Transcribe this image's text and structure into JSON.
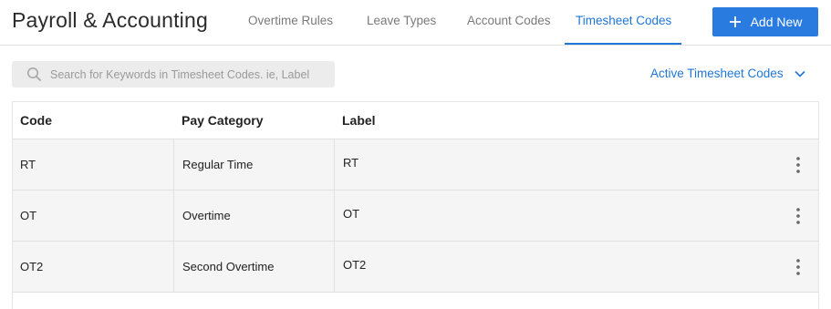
{
  "header": {
    "title": "Payroll & Accounting",
    "tabs": [
      {
        "label": "Overtime Rules",
        "active": false
      },
      {
        "label": "Leave Types",
        "active": false
      },
      {
        "label": "Account Codes",
        "active": false
      },
      {
        "label": "Timesheet Codes",
        "active": true
      }
    ],
    "add_button_label": "Add New"
  },
  "search": {
    "placeholder": "Search for Keywords in Timesheet Codes. ie, Label",
    "value": ""
  },
  "filter": {
    "selected": "Active Timesheet Codes"
  },
  "table": {
    "columns": [
      "Code",
      "Pay Category",
      "Label"
    ],
    "rows": [
      {
        "code": "RT",
        "pay_category": "Regular Time",
        "label": "RT"
      },
      {
        "code": "OT",
        "pay_category": "Overtime",
        "label": "OT"
      },
      {
        "code": "OT2",
        "pay_category": "Second Overtime",
        "label": "OT2"
      }
    ]
  },
  "colors": {
    "accent": "#1f76d6",
    "button": "#2a7be0",
    "row_background": "#f5f5f5"
  },
  "icons": {
    "add": "plus-icon",
    "search": "search-icon",
    "filter": "chevron-down-icon",
    "row_menu": "kebab-menu-icon"
  }
}
